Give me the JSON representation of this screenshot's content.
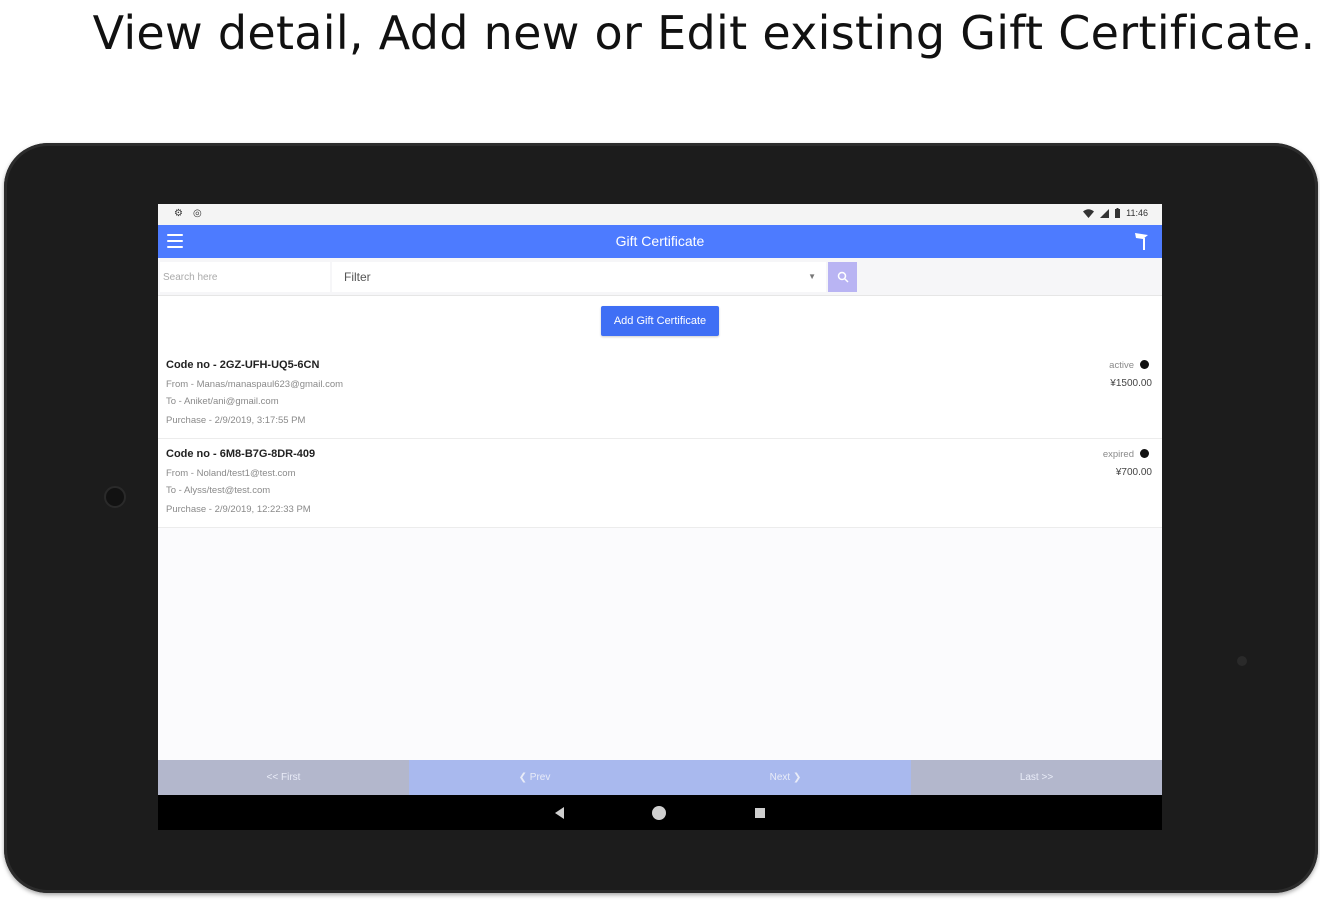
{
  "caption": "View detail, Add new or Edit existing Gift Certificate.",
  "status_bar": {
    "left_icons": [
      "settings-icon",
      "circle-icon"
    ],
    "right_icons": [
      "wifi-icon",
      "signal-icon",
      "battery-icon"
    ],
    "time": "11:46"
  },
  "app_bar": {
    "title": "Gift Certificate",
    "menu_icon": "hamburger-icon",
    "action_icon": "flag-icon"
  },
  "search": {
    "placeholder": "Search here",
    "filter_value": "Filter"
  },
  "add_button_label": "Add Gift Certificate",
  "items": [
    {
      "code": "Code no - 2GZ-UFH-UQ5-6CN",
      "from": "From - Manas/manaspaul623@gmail.com",
      "to": "To - Aniket/ani@gmail.com",
      "purchase": "Purchase - 2/9/2019, 3:17:55 PM",
      "status": "active",
      "amount": "¥1500.00"
    },
    {
      "code": "Code no - 6M8-B7G-8DR-409",
      "from": "From - Noland/test1@test.com",
      "to": "To - Alyss/test@test.com",
      "purchase": "Purchase - 2/9/2019, 12:22:33 PM",
      "status": "expired",
      "amount": "¥700.00"
    }
  ],
  "pager": {
    "first": "<< First",
    "prev": "❮ Prev",
    "next": "Next ❯",
    "last": "Last >>"
  },
  "colors": {
    "app_bar": "#4d7bff",
    "add_button": "#3f6ff5",
    "search_button": "#b9b4f3",
    "pager_gray": "#b3b7cc",
    "pager_blue": "#a9b9ee"
  }
}
